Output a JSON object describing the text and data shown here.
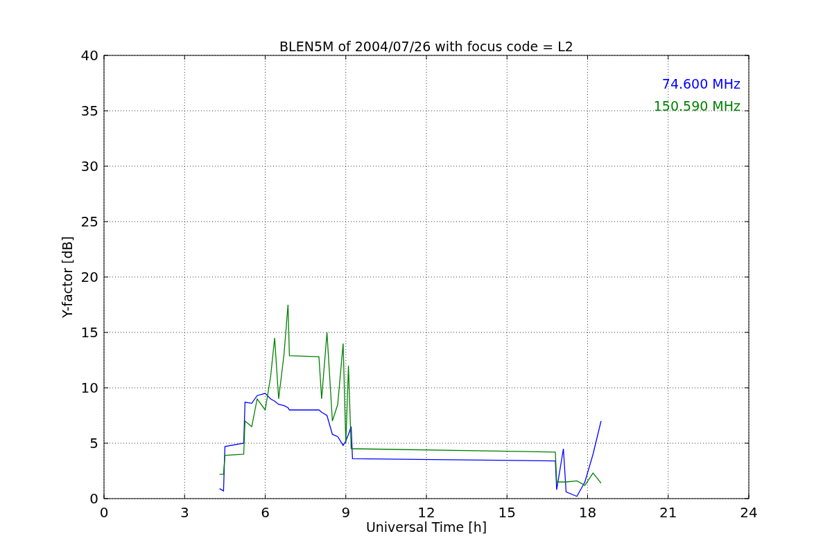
{
  "chart_data": {
    "type": "line",
    "title": "BLEN5M of 2004/07/26 with focus code = L2",
    "xlabel": "Universal Time [h]",
    "ylabel": "Y-factor [dB]",
    "x": [
      4.3,
      4.45,
      4.5,
      5.2,
      5.25,
      5.5,
      5.7,
      6.0,
      6.2,
      6.35,
      6.5,
      6.7,
      6.85,
      6.9,
      8.0,
      8.1,
      8.3,
      8.5,
      8.7,
      8.9,
      9.0,
      9.1,
      9.2,
      9.25,
      16.8,
      16.85,
      17.1,
      17.2,
      17.6,
      17.9,
      18.2,
      18.5
    ],
    "series": [
      {
        "name": "74.600 MHz",
        "color": "#0000ff",
        "values": [
          0.9,
          0.7,
          4.7,
          5.0,
          8.7,
          8.6,
          9.3,
          9.5,
          9.0,
          8.8,
          8.5,
          8.4,
          8.2,
          8.0,
          8.0,
          7.8,
          7.5,
          5.8,
          5.6,
          4.8,
          5.2,
          5.8,
          6.5,
          3.6,
          3.4,
          0.8,
          4.5,
          0.6,
          0.2,
          1.5,
          4.0,
          7.0
        ]
      },
      {
        "name": "150.590 MHz",
        "color": "#008000",
        "values": [
          2.2,
          2.2,
          3.9,
          4.0,
          7.0,
          6.5,
          9.0,
          8.0,
          11.0,
          14.5,
          9.0,
          13.0,
          17.5,
          12.9,
          12.8,
          9.0,
          15.0,
          7.0,
          8.5,
          14.0,
          5.0,
          12.0,
          4.5,
          4.5,
          4.2,
          1.5,
          1.5,
          1.5,
          1.6,
          1.2,
          2.3,
          1.4
        ]
      }
    ],
    "grid": true,
    "xlim": [
      0,
      24
    ],
    "ylim": [
      0,
      40
    ],
    "xticks": [
      0,
      3,
      6,
      9,
      12,
      15,
      18,
      21,
      24
    ],
    "yticks": [
      0,
      5,
      10,
      15,
      20,
      25,
      30,
      35,
      40
    ]
  }
}
